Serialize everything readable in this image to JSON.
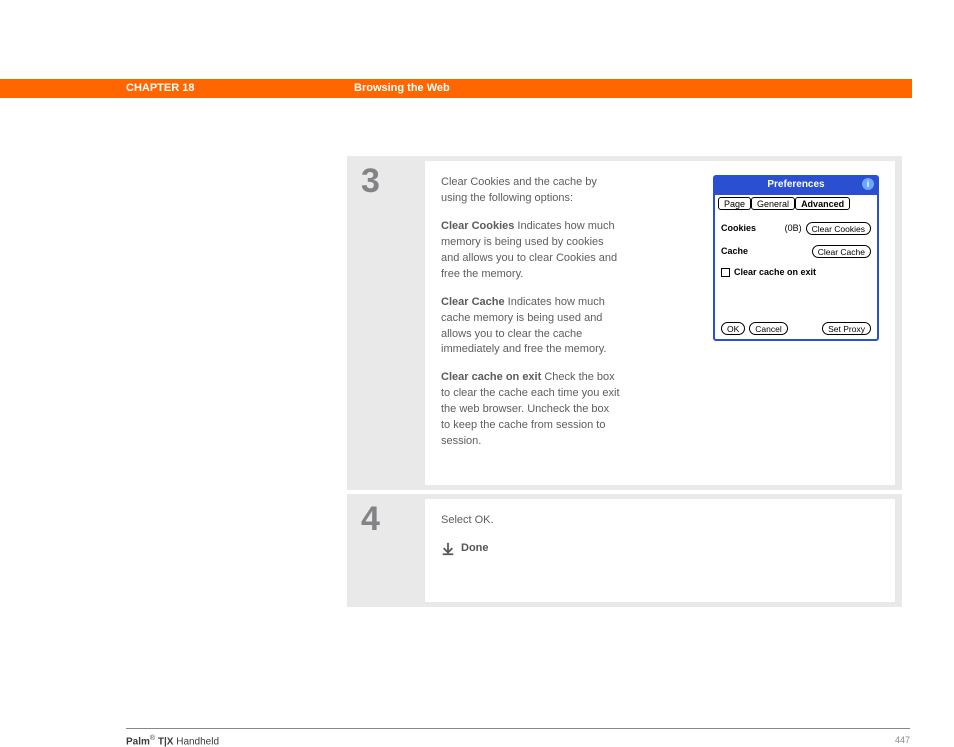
{
  "banner": {
    "chapter": "CHAPTER 18",
    "title": "Browsing the Web"
  },
  "step3": {
    "num": "3",
    "intro": "Clear Cookies and the cache by using the following options:",
    "p1_label": "Clear Cookies",
    "p1_body": "   Indicates how much memory is being used by cookies and allows you to clear Cookies and free the memory.",
    "p2_label": "Clear Cache",
    "p2_body": "   Indicates how much cache memory is being used and allows you to clear the cache immediately and free the memory.",
    "p3_label": "Clear cache on exit",
    "p3_body": "   Check the box to clear the cache each time you exit the web browser. Uncheck the box to keep the cache from session to session."
  },
  "step4": {
    "num": "4",
    "body": "Select OK.",
    "done": "Done"
  },
  "palm": {
    "title": "Preferences",
    "tabs": {
      "page": "Page",
      "general": "General",
      "advanced": "Advanced"
    },
    "cookies_label": "Cookies",
    "cookies_size": "(0B)",
    "clear_cookies_btn": "Clear Cookies",
    "cache_label": "Cache",
    "clear_cache_btn": "Clear Cache",
    "clear_on_exit": "Clear cache on exit",
    "ok": "OK",
    "cancel": "Cancel",
    "setproxy": "Set Proxy"
  },
  "footer": {
    "brand": "Palm",
    "reg": "®",
    "model": " T|X",
    "suffix": " Handheld",
    "page": "447"
  }
}
